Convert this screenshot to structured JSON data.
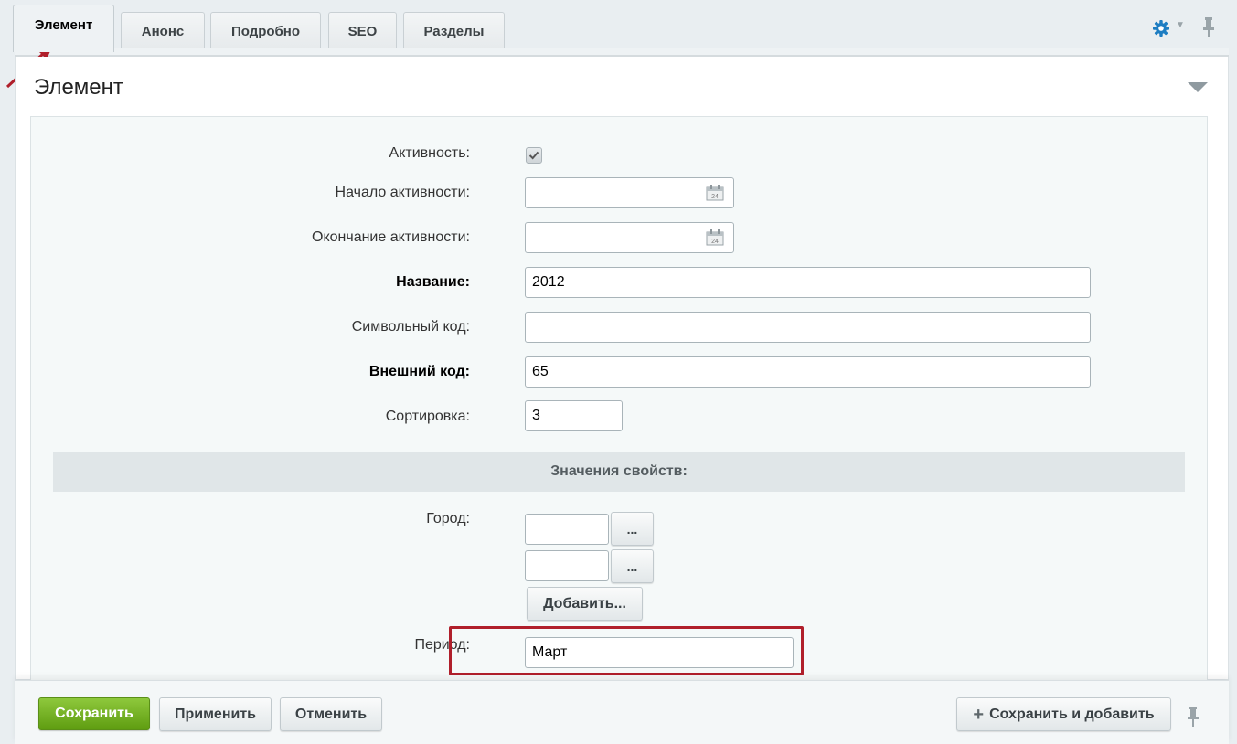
{
  "tabs": [
    {
      "label": "Элемент",
      "active": true
    },
    {
      "label": "Анонс"
    },
    {
      "label": "Подробно"
    },
    {
      "label": "SEO"
    },
    {
      "label": "Разделы"
    }
  ],
  "icons": {
    "settings": "gear-icon",
    "pin": "pin-icon",
    "calendar": "calendar-icon",
    "collapse": "triangle-down-icon"
  },
  "panel": {
    "title": "Элемент"
  },
  "form": {
    "active_label": "Активность:",
    "active_checked": true,
    "start_label": "Начало активности:",
    "start_value": "",
    "end_label": "Окончание активности:",
    "end_value": "",
    "name_label": "Название:",
    "name_value": "2012",
    "code_label": "Символьный код:",
    "code_value": "",
    "xml_label": "Внешний код:",
    "xml_value": "65",
    "sort_label": "Сортировка:",
    "sort_value": "3",
    "props_header": "Значения свойств:",
    "city_label": "Город:",
    "city_values": [
      "",
      ""
    ],
    "browse_label": "...",
    "add_label": "Добавить...",
    "period_label": "Период:",
    "period_value": "Март"
  },
  "footer": {
    "save": "Сохранить",
    "apply": "Применить",
    "cancel": "Отменить",
    "save_add": "Сохранить и добавить"
  },
  "colors": {
    "accent_green": "#6faa1f",
    "highlight_red": "#b01f2b",
    "gear_blue": "#1d7dc2"
  }
}
